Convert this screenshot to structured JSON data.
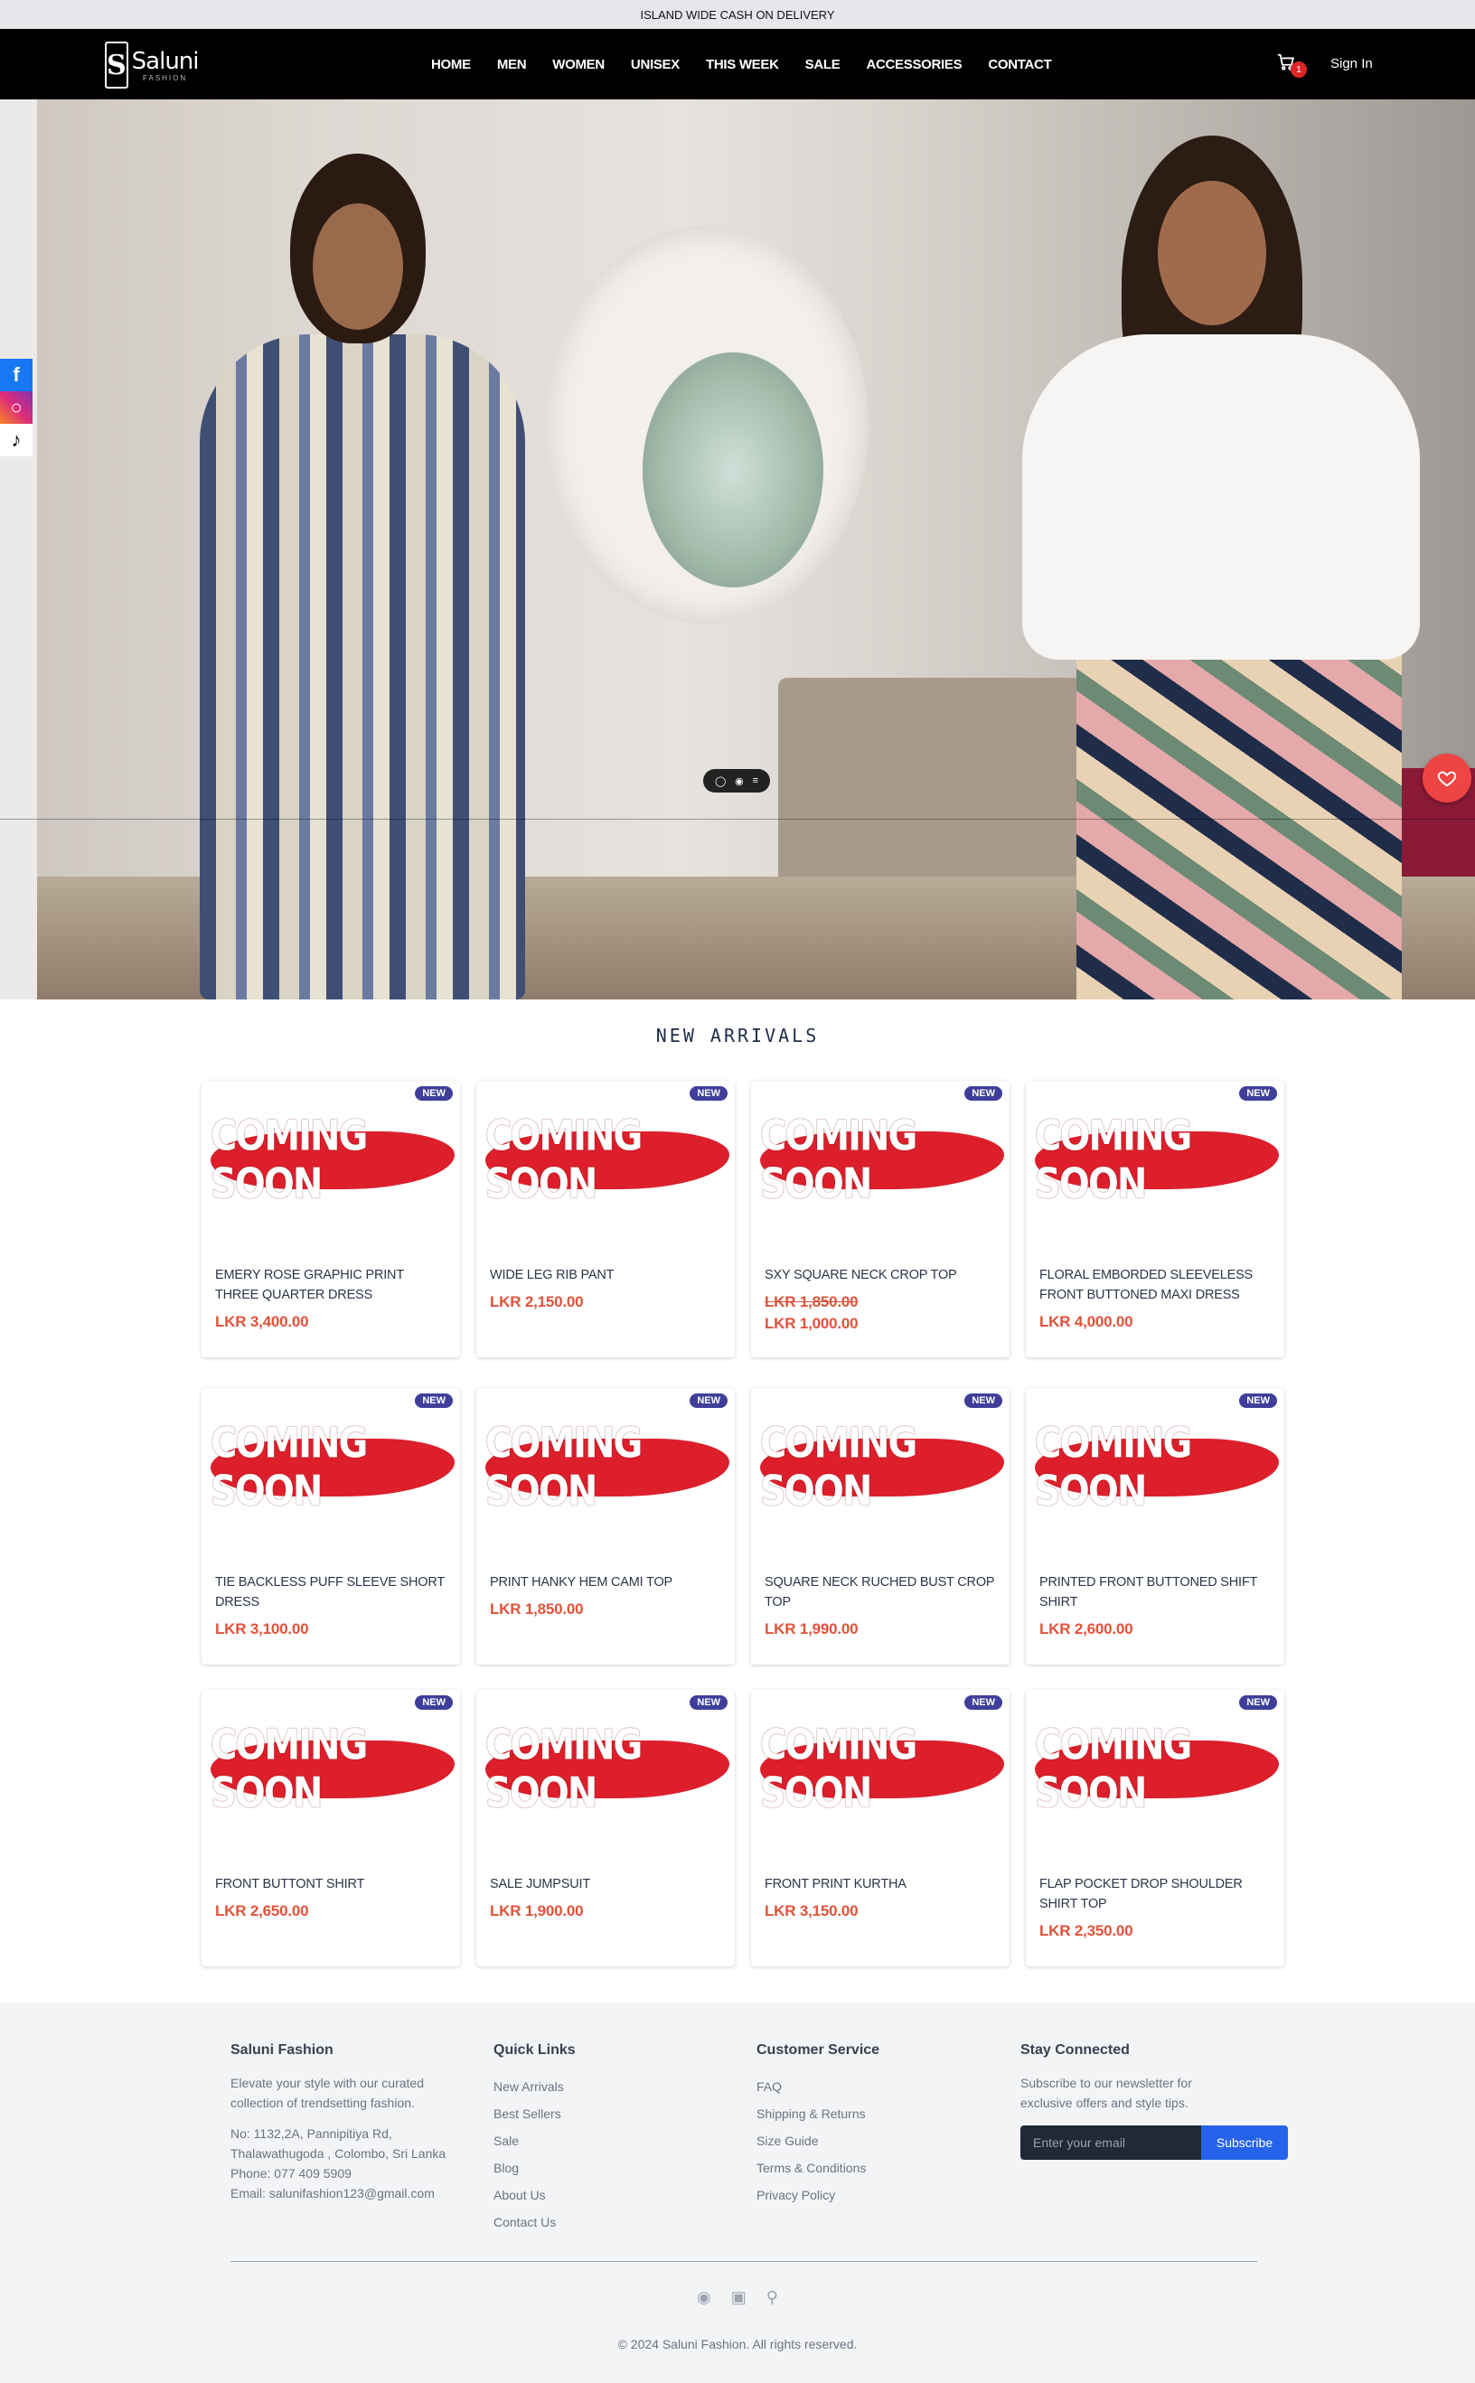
{
  "topbar": {
    "announcement": "ISLAND WIDE CASH ON DELIVERY"
  },
  "header": {
    "logo_text": "Saluni",
    "logo_sub": "FASHION",
    "menu": [
      "HOME",
      "MEN",
      "WOMEN",
      "UNISEX",
      "THIS WEEK",
      "SALE",
      "ACCESSORIES",
      "CONTACT"
    ],
    "cart_count": "1",
    "signin_label": "Sign In"
  },
  "social_sidebar": [
    "facebook-icon",
    "instagram-icon",
    "tiktok-icon"
  ],
  "hero": {
    "slider_controls": [
      "comment-icon",
      "eye-icon",
      "list-icon"
    ]
  },
  "arrivals": {
    "title": "NEW ARRIVALS",
    "badge": "NEW",
    "placeholder_text": "COMING SOON",
    "products": [
      {
        "name": "EMERY ROSE GRAPHIC PRINT THREE QUARTER DRESS",
        "price": "LKR 3,400.00",
        "old_price": ""
      },
      {
        "name": "WIDE LEG RIB PANT",
        "price": "LKR 2,150.00",
        "old_price": ""
      },
      {
        "name": "SXY SQUARE NECK CROP TOP",
        "price": "LKR 1,000.00",
        "old_price": "LKR 1,850.00"
      },
      {
        "name": "FLORAL EMBORDED SLEEVELESS FRONT BUTTONED MAXI DRESS",
        "price": "LKR 4,000.00",
        "old_price": ""
      },
      {
        "name": "TIE BACKLESS PUFF SLEEVE SHORT DRESS",
        "price": "LKR 3,100.00",
        "old_price": ""
      },
      {
        "name": "PRINT HANKY HEM CAMI TOP",
        "price": "LKR 1,850.00",
        "old_price": ""
      },
      {
        "name": "SQUARE NECK RUCHED BUST CROP TOP",
        "price": "LKR 1,990.00",
        "old_price": ""
      },
      {
        "name": "PRINTED FRONT BUTTONED SHIFT SHIRT",
        "price": "LKR 2,600.00",
        "old_price": ""
      },
      {
        "name": "FRONT BUTTONT SHIRT",
        "price": "LKR 2,650.00",
        "old_price": ""
      },
      {
        "name": "SALE JUMPSUIT",
        "price": "LKR 1,900.00",
        "old_price": ""
      },
      {
        "name": "FRONT PRINT KURTHA",
        "price": "LKR 3,150.00",
        "old_price": ""
      },
      {
        "name": "FLAP POCKET DROP SHOULDER SHIRT TOP",
        "price": "LKR 2,350.00",
        "old_price": ""
      }
    ]
  },
  "footer": {
    "about": {
      "title": "Saluni Fashion",
      "tagline": "Elevate your style with our curated collection of trendsetting fashion.",
      "address": "No: 1132,2A, Pannipitiya Rd, Thalawathugoda , Colombo, Sri Lanka",
      "phone": "Phone: 077 409 5909",
      "email": "Email: salunifashion123@gmail.com"
    },
    "quick_links": {
      "title": "Quick Links",
      "items": [
        "New Arrivals",
        "Best Sellers",
        "Sale",
        "Blog",
        "About Us",
        "Contact Us"
      ]
    },
    "customer_service": {
      "title": "Customer Service",
      "items": [
        "FAQ",
        "Shipping & Returns",
        "Size Guide",
        "Terms & Conditions",
        "Privacy Policy"
      ]
    },
    "newsletter": {
      "title": "Stay Connected",
      "text": "Subscribe to our newsletter for exclusive offers and style tips.",
      "placeholder": "Enter your email",
      "button": "Subscribe"
    },
    "icons": [
      "facebook-icon",
      "instagram-icon",
      "map-pin-icon"
    ],
    "copyright": "© 2024 Saluni Fashion. All rights reserved."
  }
}
